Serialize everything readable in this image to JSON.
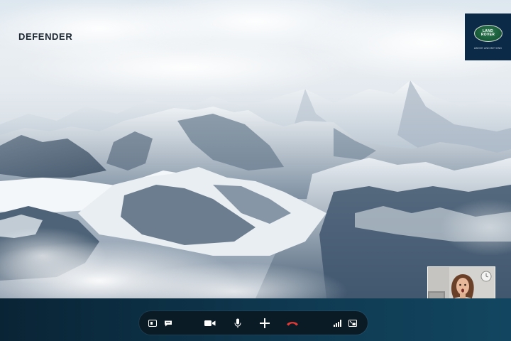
{
  "header": {
    "brand_title": "DEFENDER"
  },
  "logo": {
    "name": "land-rover-logo",
    "line1": "LAND",
    "line2": "ROVER",
    "tagline": "ABOVE AND BEYOND"
  },
  "call_controls": [
    {
      "name": "screen-share-icon"
    },
    {
      "name": "chat-icon"
    },
    {
      "name": "video-camera-icon"
    },
    {
      "name": "microphone-icon"
    },
    {
      "name": "add-icon"
    },
    {
      "name": "hang-up-icon"
    },
    {
      "name": "signal-strength-icon"
    },
    {
      "name": "picture-in-picture-icon"
    }
  ],
  "colors": {
    "bottom_bar": "#0c2b3d",
    "control_pill": "#0b1b26",
    "hang_up": "#e53935",
    "icon": "#ffffff",
    "logo_navy": "#0b2a47",
    "logo_green": "#1f6a44"
  }
}
